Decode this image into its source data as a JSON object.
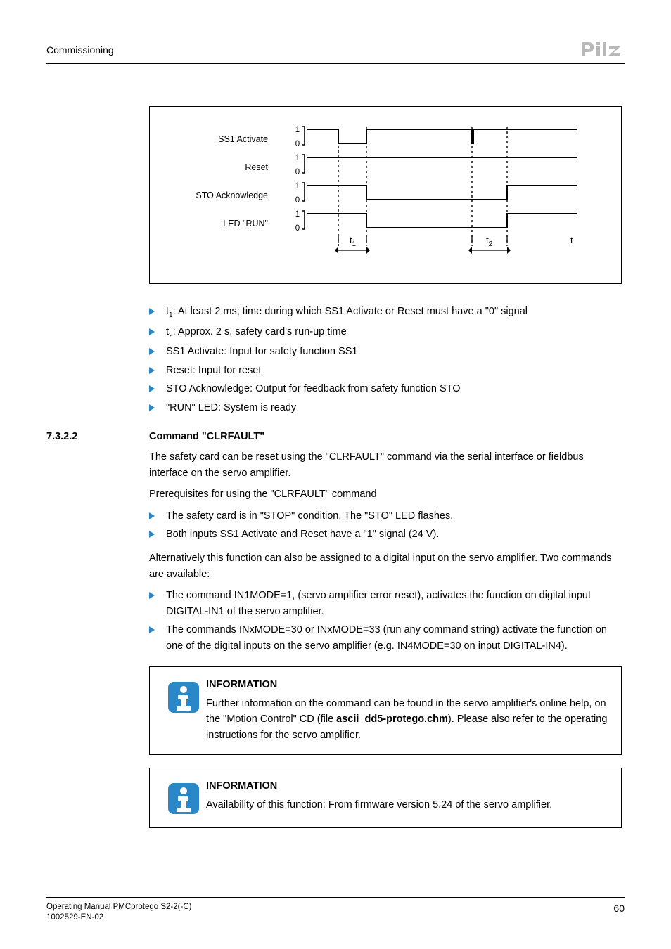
{
  "header": {
    "section": "Commissioning"
  },
  "diagram": {
    "signals": [
      {
        "name": "SS1 Activate",
        "levels": [
          "1",
          "0"
        ]
      },
      {
        "name": "Reset",
        "levels": [
          "1",
          "0"
        ]
      },
      {
        "name": "STO Acknowledge",
        "levels": [
          "1",
          "0"
        ]
      },
      {
        "name": "LED \"RUN\"",
        "levels": [
          "1",
          "0"
        ]
      }
    ],
    "axis": {
      "markers": [
        "t1",
        "t2",
        "t"
      ]
    }
  },
  "legend": [
    {
      "html": "t<sub class='s'>1</sub>: At least 2 ms; time during which SS1 Activate or Reset must have a \"0\" signal"
    },
    {
      "html": "t<sub class='s'>2</sub>: Approx. 2 s, safety card's run-up time"
    },
    {
      "html": "SS1 Activate: Input for safety function SS1"
    },
    {
      "html": "Reset: Input for reset"
    },
    {
      "html": "STO Acknowledge: Output for feedback from safety function STO"
    },
    {
      "html": "\"RUN\" LED: System is ready"
    }
  ],
  "heading": {
    "num": "7.3.2.2",
    "title": "Command \"CLRFAULT\""
  },
  "p1": "The safety card can be reset using the \"CLRFAULT\" command via the serial interface or fieldbus interface on the servo amplifier.",
  "p2": "Prerequisites for using the \"CLRFAULT\" command",
  "prereq": [
    "The safety card is in \"STOP\" condition. The \"STO\" LED flashes.",
    "Both inputs SS1 Activate and Reset have a \"1\" signal (24 V)."
  ],
  "p3": "Alternatively this function can also be assigned to a digital input on the servo amplifier. Two commands are available:",
  "cmds": [
    "The command IN1MODE=1, (servo amplifier error reset), activates the function on digital input DIGITAL-IN1 of the servo amplifier.",
    "The commands INxMODE=30 or INxMODE=33 (run any command string) activate the function on one of the digital inputs on the servo amplifier (e.g. IN4MODE=30 on input DIGITAL-IN4)."
  ],
  "info1": {
    "head": "INFORMATION",
    "pre": "Further information on the command can be found in the servo amplifier's online help, on the \"Motion Control\" CD (file ",
    "bold": "ascii_dd5-protego.chm",
    "post": "). Please also refer to the operating instructions for the servo amplifier."
  },
  "info2": {
    "head": "INFORMATION",
    "text": "Availability of this function: From firmware version 5.24 of the servo amplifier."
  },
  "footer": {
    "l1": "Operating Manual PMCprotego S2-2(-C)",
    "l2": "1002529-EN-02",
    "page": "60"
  }
}
